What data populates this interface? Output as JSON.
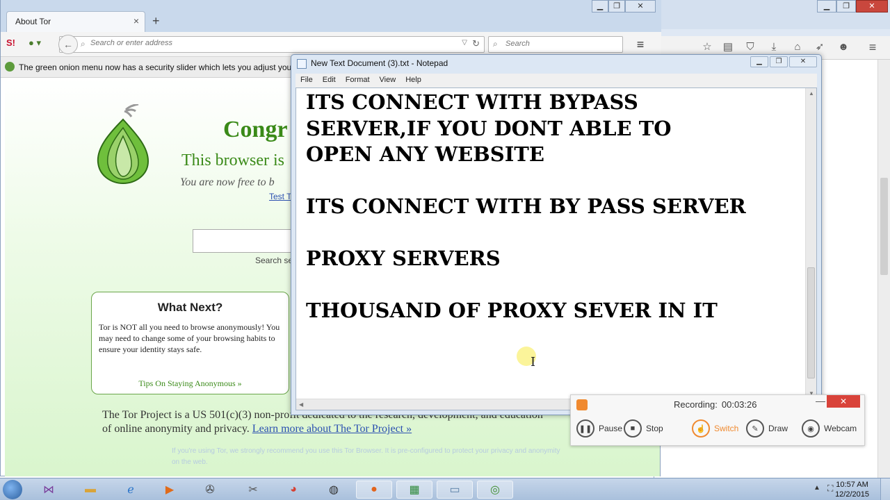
{
  "tor_browser": {
    "tab_title": "About Tor",
    "tab_close": "×",
    "new_tab": "+",
    "url_placeholder": "Search or enter address",
    "search_placeholder": "Search",
    "notification": "The green onion menu now has a security slider which lets you adjust your secu",
    "page": {
      "heading": "Congr",
      "subheading": "This browser is",
      "free_text": "You are now free to b",
      "test_link": "Test T",
      "search_hint": "Search se",
      "what_next": {
        "title": "What Next?",
        "body": "Tor is NOT all you need to browse anonymously! You may need to change some of your browsing habits to ensure your identity stays safe.",
        "link": "Tips On Staying Anonymous »"
      },
      "footer_text": "The Tor Project is a US 501(c)(3) non-profit dedicated to the research, development, and education of online anonymity and privacy.",
      "footer_link": "Learn more about The Tor Project »",
      "faded_text": "If you're using Tor, we strongly recommend you use this Tor Browser. It is pre-configured to protect your privacy and anonymity on the web."
    }
  },
  "notepad": {
    "title": "New Text Document (3).txt - Notepad",
    "menu": [
      "File",
      "Edit",
      "Format",
      "View",
      "Help"
    ],
    "content": "ITS CONNECT WITH BYPASS\nSERVER,IF YOU DONT ABLE TO\nOPEN ANY WEBSITE\n\nITS CONNECT WITH BY PASS SERVER\n\nPROXY SERVERS\n\nTHOUSAND OF PROXY SEVER IN IT"
  },
  "recorder": {
    "status_label": "Recording:",
    "time": "00:03:26",
    "buttons": {
      "pause": "Pause",
      "stop": "Stop",
      "switch": "Switch",
      "draw": "Draw",
      "webcam": "Webcam"
    },
    "accent_color": "#f08a30"
  },
  "taskbar": {
    "time": "10:57 AM",
    "date": "12/2/2015"
  },
  "colors": {
    "tor_green": "#3a8a18",
    "link_blue": "#2a4fb0",
    "close_red": "#c9473d"
  }
}
